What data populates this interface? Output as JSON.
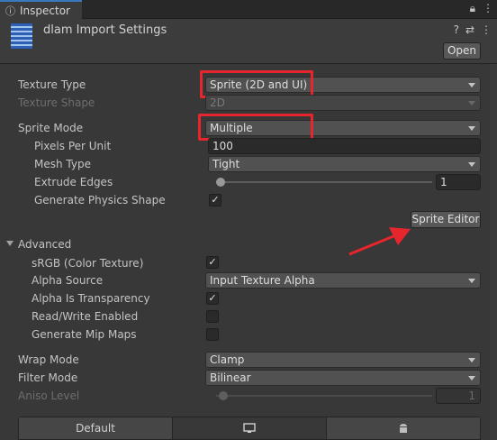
{
  "tab": {
    "title": "Inspector"
  },
  "header": {
    "asset_title": "dlam Import Settings",
    "open_label": "Open"
  },
  "texture_type": {
    "label": "Texture Type",
    "value": "Sprite (2D and UI)"
  },
  "texture_shape": {
    "label": "Texture Shape",
    "value": "2D"
  },
  "sprite_mode": {
    "label": "Sprite Mode",
    "value": "Multiple"
  },
  "pixels_per_unit": {
    "label": "Pixels Per Unit",
    "value": "100"
  },
  "mesh_type": {
    "label": "Mesh Type",
    "value": "Tight"
  },
  "extrude_edges": {
    "label": "Extrude Edges",
    "value": "1"
  },
  "generate_physics_shape": {
    "label": "Generate Physics Shape"
  },
  "sprite_editor": {
    "label": "Sprite Editor"
  },
  "advanced": {
    "title": "Advanced",
    "srgb": {
      "label": "sRGB (Color Texture)"
    },
    "alpha_source": {
      "label": "Alpha Source",
      "value": "Input Texture Alpha"
    },
    "alpha_is_transparency": {
      "label": "Alpha Is Transparency"
    },
    "read_write": {
      "label": "Read/Write Enabled"
    },
    "mipmaps": {
      "label": "Generate Mip Maps"
    }
  },
  "wrap_mode": {
    "label": "Wrap Mode",
    "value": "Clamp"
  },
  "filter_mode": {
    "label": "Filter Mode",
    "value": "Bilinear"
  },
  "aniso_level": {
    "label": "Aniso Level",
    "value": "1"
  },
  "platforms": {
    "default_label": "Default"
  },
  "colors": {
    "highlight": "#e7252d",
    "arrow": "#e7252d"
  }
}
